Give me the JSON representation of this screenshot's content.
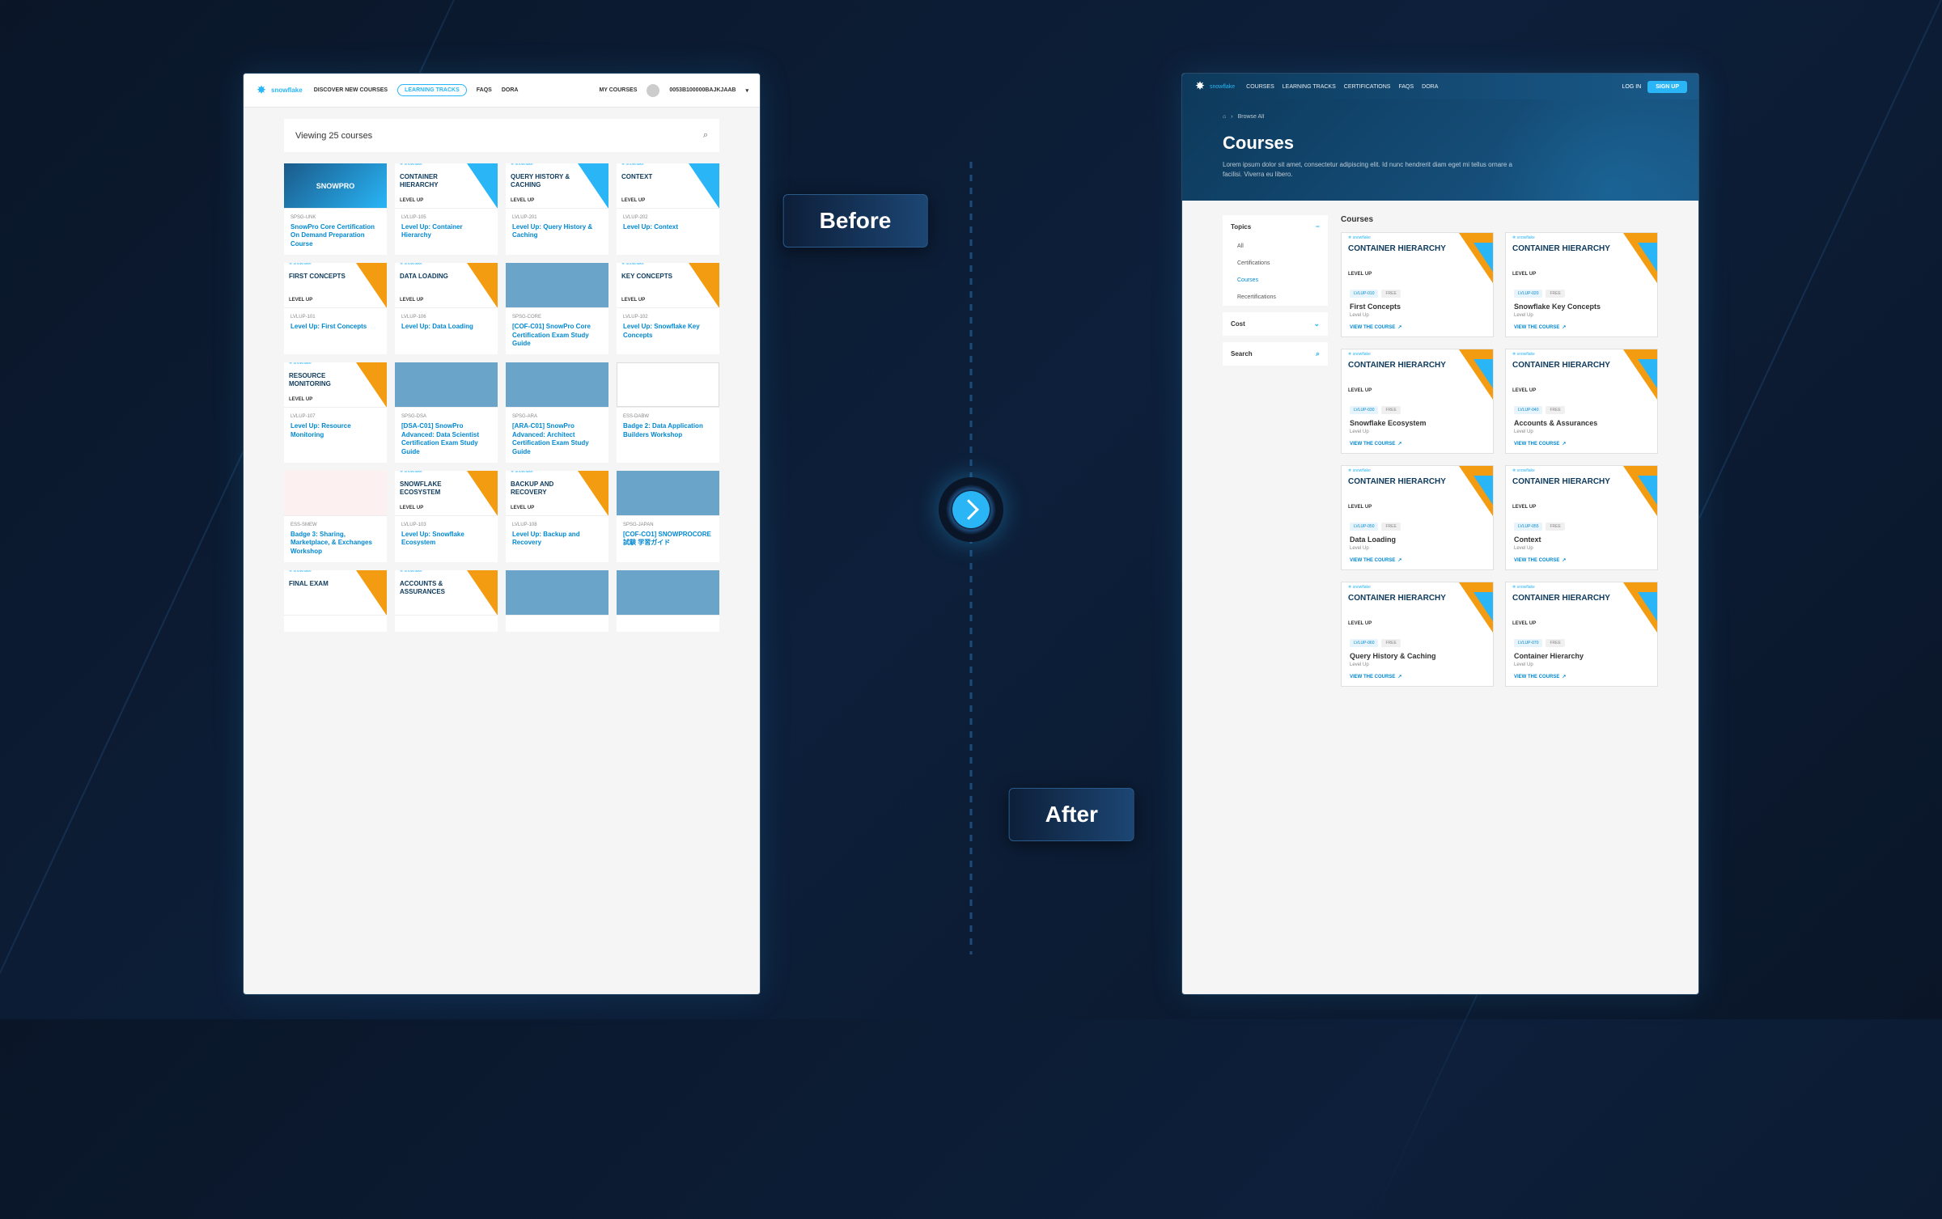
{
  "labels": {
    "before": "Before",
    "after": "After"
  },
  "brand": "snowflake",
  "before": {
    "nav": {
      "discover": "DISCOVER NEW COURSES",
      "tracks": "LEARNING TRACKS",
      "faqs": "FAQS",
      "dora": "DORA",
      "mycourses": "MY COURSES",
      "user": "0053B100000BAJKJAAB"
    },
    "viewing": "Viewing 25 courses",
    "cards": [
      {
        "thumb_type": "img",
        "img_text": "SNOWPRO",
        "code": "SPSG-UNK",
        "title": "SnowPro Core Certification On Demand Preparation Course"
      },
      {
        "thumb_type": "wedge",
        "wedge": "blue",
        "thumb_title": "CONTAINER HIERARCHY",
        "thumb_sub": "LEVEL UP",
        "code": "LVLUP-105",
        "title": "Level Up: Container Hierarchy"
      },
      {
        "thumb_type": "wedge",
        "wedge": "blue",
        "thumb_title": "QUERY HISTORY & CACHING",
        "thumb_sub": "LEVEL UP",
        "code": "LVLUP-201",
        "title": "Level Up: Query History & Caching"
      },
      {
        "thumb_type": "wedge",
        "wedge": "blue",
        "thumb_title": "CONTEXT",
        "thumb_sub": "LEVEL UP",
        "code": "LVLUP-202",
        "title": "Level Up: Context"
      },
      {
        "thumb_type": "wedge",
        "wedge": "orange",
        "thumb_title": "FIRST CONCEPTS",
        "thumb_sub": "LEVEL UP",
        "code": "LVLUP-101",
        "title": "Level Up: First Concepts"
      },
      {
        "thumb_type": "wedge",
        "wedge": "orange",
        "thumb_title": "DATA LOADING",
        "thumb_sub": "LEVEL UP",
        "code": "LVLUP-106",
        "title": "Level Up: Data Loading"
      },
      {
        "thumb_type": "photo",
        "code": "SPSG-CORE",
        "title": "[COF-C01] SnowPro Core Certification Exam Study Guide"
      },
      {
        "thumb_type": "wedge",
        "wedge": "orange",
        "thumb_title": "KEY CONCEPTS",
        "thumb_sub": "LEVEL UP",
        "code": "LVLUP-102",
        "title": "Level Up: Snowflake Key Concepts"
      },
      {
        "thumb_type": "wedge",
        "wedge": "orange",
        "thumb_title": "RESOURCE MONITORING",
        "thumb_sub": "LEVEL UP",
        "code": "LVLUP-107",
        "title": "Level Up: Resource Monitoring"
      },
      {
        "thumb_type": "photo",
        "code": "SPSG-DSA",
        "title": "[DSA-C01] SnowPro Advanced: Data Scientist Certification Exam Study Guide"
      },
      {
        "thumb_type": "photo",
        "code": "SPSG-ARA",
        "title": "[ARA-C01] SnowPro Advanced: Architect Certification Exam Study Guide"
      },
      {
        "thumb_type": "illus",
        "code": "ESS-DABW",
        "title": "Badge 2: Data Application Builders Workshop"
      },
      {
        "thumb_type": "illus2",
        "code": "ESS-SMEW",
        "title": "Badge 3: Sharing, Marketplace, & Exchanges Workshop"
      },
      {
        "thumb_type": "wedge",
        "wedge": "orange",
        "thumb_title": "SNOWFLAKE ECOSYSTEM",
        "thumb_sub": "LEVEL UP",
        "code": "LVLUP-103",
        "title": "Level Up: Snowflake Ecosystem"
      },
      {
        "thumb_type": "wedge",
        "wedge": "orange",
        "thumb_title": "BACKUP AND RECOVERY",
        "thumb_sub": "LEVEL UP",
        "code": "LVLUP-108",
        "title": "Level Up: Backup and Recovery"
      },
      {
        "thumb_type": "photo",
        "code": "SPSG-JAPAN",
        "title": "[COF-CO1] SNOWPROCORE試験 学習ガイド"
      },
      {
        "thumb_type": "wedge",
        "wedge": "orange",
        "thumb_title": "FINAL EXAM",
        "thumb_sub": "",
        "code": "",
        "title": ""
      },
      {
        "thumb_type": "wedge",
        "wedge": "orange",
        "thumb_title": "ACCOUNTS & ASSURANCES",
        "thumb_sub": "",
        "code": "",
        "title": ""
      },
      {
        "thumb_type": "photo",
        "code": "",
        "title": ""
      },
      {
        "thumb_type": "photo",
        "code": "",
        "title": ""
      }
    ]
  },
  "after": {
    "nav": {
      "courses": "COURSES",
      "tracks": "LEARNING TRACKS",
      "certs": "CERTIFICATIONS",
      "faqs": "FAQS",
      "dora": "DORA",
      "login": "LOG IN",
      "signup": "SIGN UP"
    },
    "breadcrumb": {
      "home": "⌂",
      "sep": "›",
      "current": "Browse All"
    },
    "hero": {
      "title": "Courses",
      "sub": "Lorem ipsum dolor sit amet, consectetur adipiscing elit. Id nunc hendrerit diam eget mi tellus ornare a facilisi. Viverra eu libero."
    },
    "filters": {
      "topics": {
        "label": "Topics",
        "items": [
          "All",
          "Certifications",
          "Courses",
          "Recertifications"
        ],
        "selected": "Courses"
      },
      "cost": {
        "label": "Cost"
      },
      "search": {
        "label": "Search"
      }
    },
    "section_title": "Courses",
    "thumb_title": "CONTAINER HIERARCHY",
    "thumb_sub": "LEVEL UP",
    "badge_code_prefix": "LVLUP-",
    "badge_free": "FREE",
    "view_course": "VIEW THE COURSE",
    "card_sub": "Level Up",
    "cards": [
      {
        "code": "010",
        "title": "First Concepts"
      },
      {
        "code": "020",
        "title": "Snowflake Key Concepts"
      },
      {
        "code": "030",
        "title": "Snowflake Ecosystem"
      },
      {
        "code": "040",
        "title": "Accounts & Assurances"
      },
      {
        "code": "050",
        "title": "Data Loading"
      },
      {
        "code": "055",
        "title": "Context"
      },
      {
        "code": "060",
        "title": "Query History & Caching"
      },
      {
        "code": "070",
        "title": "Container Hierarchy"
      }
    ]
  }
}
